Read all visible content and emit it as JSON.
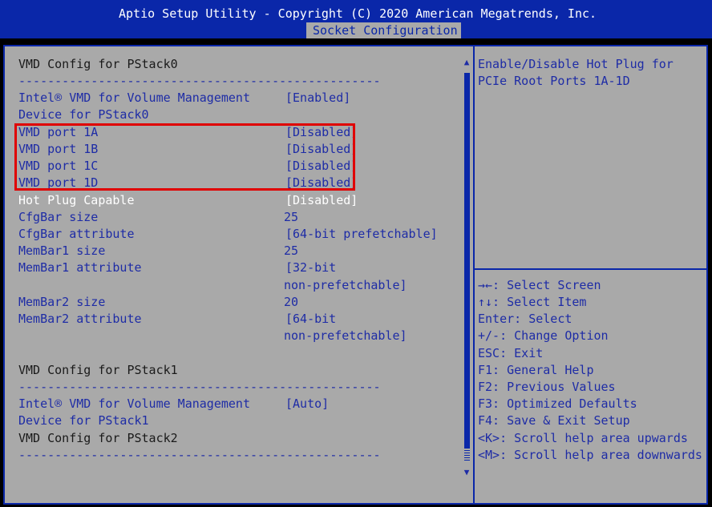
{
  "header": {
    "title": "Aptio Setup Utility - Copyright (C) 2020 American Megatrends, Inc.",
    "tab": "Socket Configuration"
  },
  "left": {
    "pstack0_heading": "VMD Config for PStack0",
    "separator": "--------------------------------------------------",
    "vmd_mgmt_label": "Intel® VMD for Volume Management",
    "vmd_mgmt_value": "[Enabled]",
    "device_pstack0": "Device for PStack0",
    "ports": [
      {
        "label": "VMD port 1A",
        "value": "[Disabled]"
      },
      {
        "label": "VMD port 1B",
        "value": "[Disabled]"
      },
      {
        "label": "VMD port 1C",
        "value": "[Disabled]"
      },
      {
        "label": "VMD port 1D",
        "value": "[Disabled]"
      }
    ],
    "hotplug_label": "Hot Plug Capable",
    "hotplug_value": "[Disabled]",
    "cfgbar_size_label": "CfgBar size",
    "cfgbar_size_value": "25",
    "cfgbar_attr_label": "CfgBar attribute",
    "cfgbar_attr_value": "[64-bit prefetchable]",
    "membar1_size_label": "MemBar1 size",
    "membar1_size_value": "25",
    "membar1_attr_label": "MemBar1 attribute",
    "membar1_attr_value1": "[32-bit",
    "membar1_attr_value2": "non-prefetchable]",
    "membar2_size_label": "MemBar2 size",
    "membar2_size_value": "20",
    "membar2_attr_label": "MemBar2 attribute",
    "membar2_attr_value1": "[64-bit",
    "membar2_attr_value2": "non-prefetchable]",
    "pstack1_heading": "VMD Config for PStack1",
    "vmd_mgmt1_label": "Intel® VMD for Volume Management",
    "vmd_mgmt1_value": "[Auto]",
    "device_pstack1": "Device for PStack1",
    "pstack2_heading": "VMD Config for PStack2"
  },
  "help": {
    "line1": "Enable/Disable Hot Plug for",
    "line2": "PCIe Root Ports 1A-1D"
  },
  "keys": [
    "→←: Select Screen",
    "↑↓: Select Item",
    "Enter: Select",
    "+/-: Change Option",
    "ESC: Exit",
    "F1: General Help",
    "F2: Previous Values",
    "F3: Optimized Defaults",
    "F4: Save & Exit Setup",
    "<K>: Scroll help area upwards",
    "<M>: Scroll help area downwards"
  ],
  "scroll": {
    "up": "▲",
    "down": "▼"
  }
}
